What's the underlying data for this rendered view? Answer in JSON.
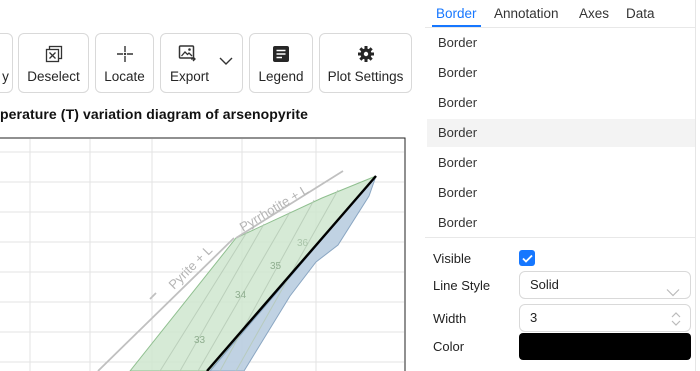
{
  "toolbar": {
    "partial_label": "y",
    "deselect_label": "Deselect",
    "locate_label": "Locate",
    "export_label": "Export",
    "legend_label": "Legend",
    "plot_settings_label": "Plot Settings"
  },
  "chart": {
    "title": "perature (T) variation diagram of arsenopyrite",
    "annotations": {
      "pyrite_l": "Pyrite + L",
      "pyrrhotite_l": "Pyrrhotite + L"
    },
    "isopleth_labels": [
      "33",
      "34",
      "35",
      "36"
    ],
    "colors": {
      "field_green": "#cfe6cf",
      "field_blue": "#b9cde0",
      "boundary": "#000000",
      "annotation": "#b5b5b5",
      "grid": "#e3e3e3"
    }
  },
  "panel": {
    "tabs": [
      "Border",
      "Annotation",
      "Axes",
      "Data"
    ],
    "active_tab": "Border",
    "border_items": [
      "Border",
      "Border",
      "Border",
      "Border",
      "Border",
      "Border",
      "Border"
    ],
    "hovered_index": 3,
    "visible_label": "Visible",
    "visible_checked": true,
    "line_style_label": "Line Style",
    "line_style_value": "Solid",
    "width_label": "Width",
    "width_value": "3",
    "color_label": "Color",
    "color_value": "#000000",
    "accent_color": "#1677ff"
  }
}
